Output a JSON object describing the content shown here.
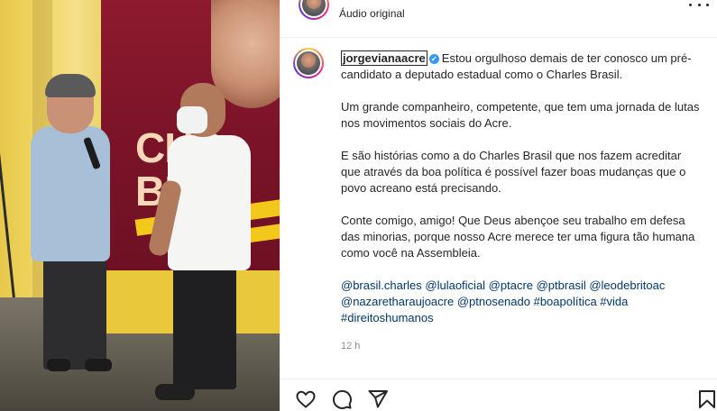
{
  "post": {
    "header_subtitle": "Áudio original",
    "author": "jorgevianaacre",
    "verified_badge": "✔",
    "caption_first": "Estou orgulhoso demais de ter conosco um pré-candidato a deputado estadual como o Charles Brasil.",
    "caption_paragraphs": [
      "Um grande companheiro, competente, que tem uma jornada de lutas nos movimentos sociais do Acre.",
      "E são histórias como a do Charles Brasil que nos fazem acreditar que através da boa política é possível fazer boas mudanças que o povo acreano está precisando.",
      "Conte comigo, amigo! Que Deus abençoe seu trabalho em defesa das minorias, porque nosso Acre merece ter uma figura tão humana como você na Assembleia."
    ],
    "hashtags": "@brasil.charles @lulaoficial @ptacre @ptbrasil @leodebritoac @nazaretharaujoacre @ptnosenado #boapolítica #vida #direitoshumanos",
    "timestamp": "12 h"
  },
  "media": {
    "banner_text_line1": "CHC",
    "banner_text_line2": "BI"
  },
  "icons": {
    "more": "more-options-icon",
    "like": "heart-icon",
    "comment": "comment-icon",
    "share": "share-icon",
    "save": "bookmark-icon"
  },
  "colors": {
    "link": "#00376b",
    "verified": "#3897f0",
    "muted": "#8e8e8e"
  }
}
